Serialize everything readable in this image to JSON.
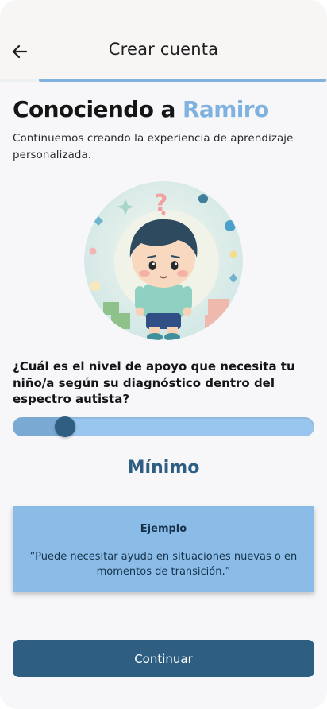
{
  "header": {
    "title": "Crear cuenta",
    "back_icon": "arrow-left-icon"
  },
  "progress": {
    "value": 0.88
  },
  "intro": {
    "title_prefix": "Conociendo a ",
    "child_name": "Ramiro",
    "subtitle": "Continuemos creando la experiencia de aprendizaje personalizada."
  },
  "question": {
    "text": "¿Cuál es el nivel de apoyo que necesita tu niño/a según su diagnóstico dentro del espectro autista?"
  },
  "slider": {
    "value": 0.15,
    "selected_label": "Mínimo"
  },
  "example": {
    "title": "Ejemplo",
    "text": "“Puede necesitar ayuda en situaciones nuevas o en momentos de transición.”"
  },
  "actions": {
    "continue_label": "Continuar"
  },
  "colors": {
    "accent": "#7fb2de",
    "primary": "#2e5f82",
    "card": "#8bbce7"
  }
}
